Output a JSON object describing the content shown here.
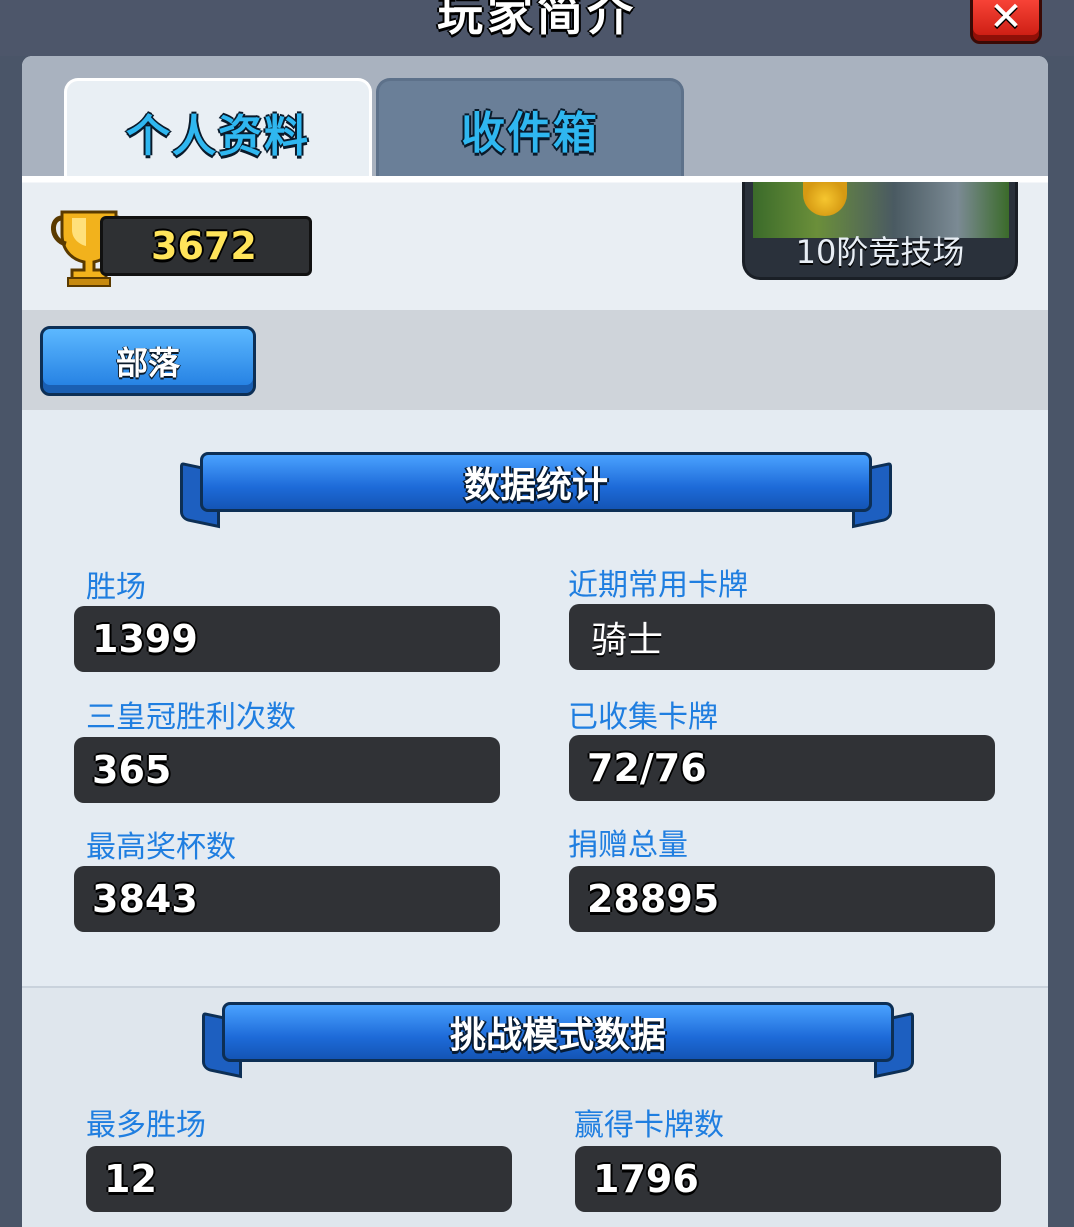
{
  "window": {
    "title": "玩家简介",
    "close_glyph": "✕"
  },
  "tabs": [
    {
      "label": "个人资料",
      "active": true
    },
    {
      "label": "收件箱",
      "active": false
    }
  ],
  "player": {
    "trophies": "3672",
    "arena": "10阶竞技场"
  },
  "clan": {
    "button_label": "部落"
  },
  "stats": {
    "title": "数据统计",
    "items": [
      {
        "label": "胜场",
        "value": "1399"
      },
      {
        "label": "近期常用卡牌",
        "value": "骑士"
      },
      {
        "label": "三皇冠胜利次数",
        "value": "365"
      },
      {
        "label": "已收集卡牌",
        "value": "72/76"
      },
      {
        "label": "最高奖杯数",
        "value": "3843"
      },
      {
        "label": "捐赠总量",
        "value": "28895"
      }
    ]
  },
  "challenge": {
    "title": "挑战模式数据",
    "items": [
      {
        "label": "最多胜场",
        "value": "12"
      },
      {
        "label": "赢得卡牌数",
        "value": "1796"
      }
    ]
  },
  "colors": {
    "accent_blue": "#1f7ee0",
    "trophy_gold": "#ffe45a",
    "close_red": "#e0291c"
  }
}
